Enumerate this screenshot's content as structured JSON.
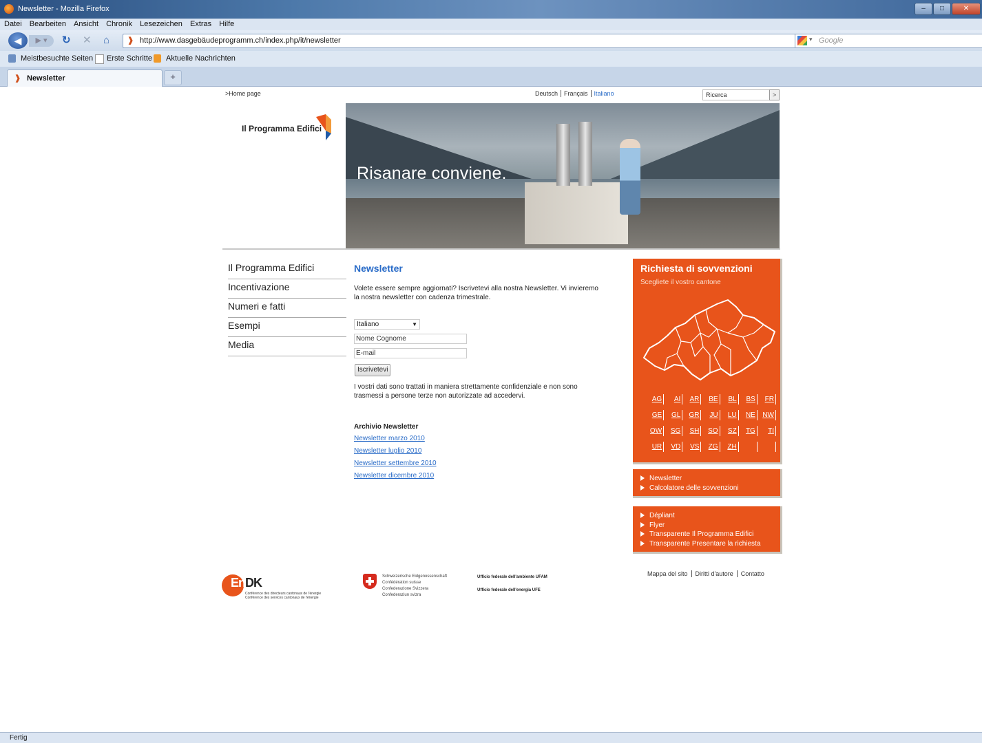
{
  "window": {
    "title": "Newsletter - Mozilla Firefox"
  },
  "menu": [
    "Datei",
    "Bearbeiten",
    "Ansicht",
    "Chronik",
    "Lesezeichen",
    "Extras",
    "Hilfe"
  ],
  "nav": {
    "url": "http://www.dasgebäudeprogramm.ch/index.php/it/newsletter",
    "search_placeholder": "Google"
  },
  "bookmarks": [
    "Meistbesuchte Seiten",
    "Erste Schritte",
    "Aktuelle Nachrichten"
  ],
  "tab": {
    "title": "Newsletter",
    "new_tab": "+"
  },
  "status": "Fertig",
  "site": {
    "home_link": ">Home page",
    "langs": [
      "Deutsch",
      "Français",
      "Italiano"
    ],
    "search_label": "Ricerca",
    "search_button": ">",
    "logo_text": "Il Programma Edifici",
    "slogan": "Risanare conviene.",
    "left_nav": [
      "Il Programma Edifici",
      "Incentivazione",
      "Numeri e fatti",
      "Esempi",
      "Media"
    ],
    "newsletter": {
      "title": "Newsletter",
      "intro": "Volete essere sempre aggiornati? Iscrivetevi alla nostra Newsletter. Vi invieremo la nostra newsletter con cadenza trimestrale.",
      "language_value": "Italiano",
      "name_value": "Nome Cognome",
      "email_value": "E-mail",
      "submit": "Iscrivetevi",
      "privacy": "I vostri dati sono trattati in maniera strettamente confidenziale e non sono trasmessi a persone terze non autorizzate ad accedervi.",
      "archive_title": "Archivio Newsletter",
      "archive": [
        "Newsletter marzo 2010",
        "Newsletter luglio 2010",
        "Newsletter settembre 2010",
        "Newsletter dicembre 2010"
      ]
    },
    "subsidy": {
      "title": "Richiesta di sovvenzioni",
      "subtitle": "Scegliete il vostro cantone",
      "cantons": [
        "AG",
        "AI",
        "AR",
        "BE",
        "BL",
        "BS",
        "FR",
        "GE",
        "GL",
        "GR",
        "JU",
        "LU",
        "NE",
        "NW",
        "OW",
        "SG",
        "SH",
        "SO",
        "SZ",
        "TG",
        "TI",
        "UR",
        "VD",
        "VS",
        "ZG",
        "ZH",
        "",
        ""
      ]
    },
    "links_box1": [
      "Newsletter",
      "Calcolatore delle sovvenzioni"
    ],
    "links_box2": [
      "Dépliant",
      "Flyer",
      "Transparente Il Programma Edifici",
      "Transparente Presentare la richiesta"
    ],
    "footer": {
      "endk": {
        "en": "En",
        "dk": "DK",
        "line1": "Conférence des directeurs cantonaux de l'énergie",
        "line2": "Conférence des services cantonaux de l'énergie"
      },
      "confed": [
        "Schweizerische Eidgenossenschaft",
        "Confédération suisse",
        "Confederazione Svizzera",
        "Confederaziun svizra"
      ],
      "uffici": [
        "Ufficio federale dell'ambiente UFAM",
        "Ufficio federale dell'energia UFE"
      ],
      "links": [
        "Mappa del sito",
        "Diritti d'autore",
        "Contatto"
      ]
    }
  },
  "colors": {
    "accent": "#e8541b",
    "link": "#2a6cc8"
  }
}
